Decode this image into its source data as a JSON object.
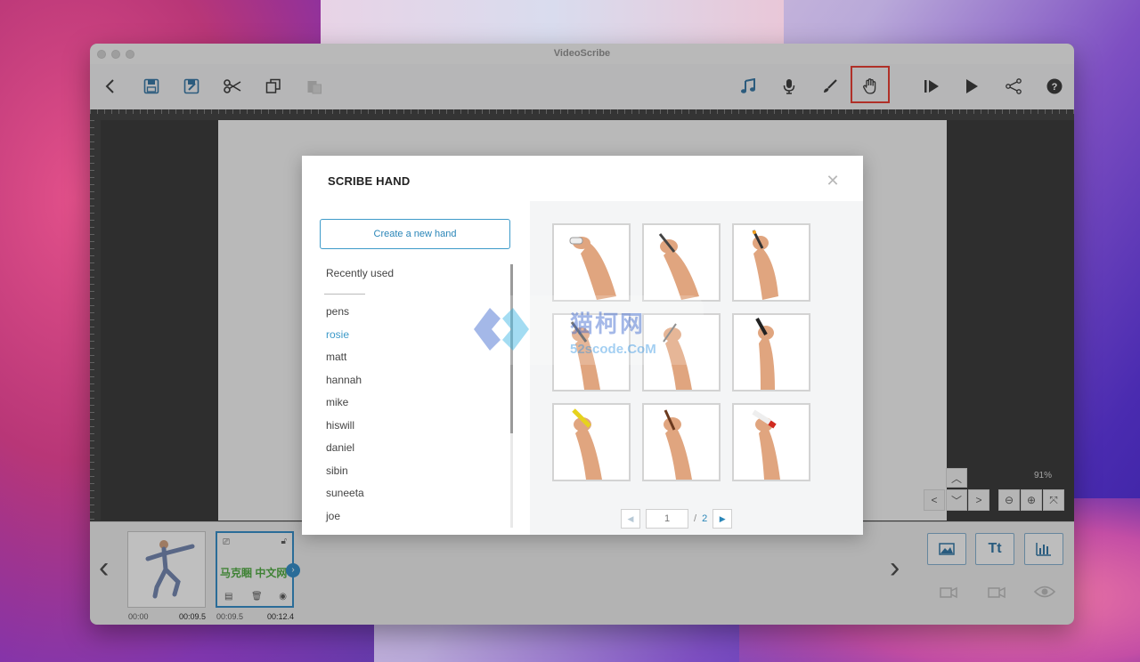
{
  "window": {
    "title": "VideoScribe"
  },
  "toolbar": {
    "left_icons": [
      "back-icon",
      "save-icon",
      "save-as-icon",
      "cut-icon",
      "copy-icon",
      "paste-icon"
    ],
    "right_icons": [
      "music-icon",
      "microphone-icon",
      "brush-icon",
      "hand-icon",
      "preview-from-icon",
      "play-icon",
      "share-icon",
      "help-icon"
    ],
    "active": "hand-icon",
    "active_color": "#e0362b"
  },
  "canvas": {
    "zoom": "91%"
  },
  "timeline": {
    "frames": [
      {
        "start": "00:00",
        "end": "00:09.5"
      },
      {
        "start": "00:09.5",
        "end": "00:12.4",
        "text": "马克睏 中文网"
      }
    ],
    "buttons": {
      "image": "image-icon",
      "text": "Tt",
      "chart": "chart-icon"
    }
  },
  "modal": {
    "title": "SCRIBE HAND",
    "create_button": "Create a new hand",
    "section": "Recently used",
    "hands": [
      "pens",
      "rosie",
      "matt",
      "hannah",
      "mike",
      "hiswill",
      "daniel",
      "sibin",
      "suneeta",
      "joe"
    ],
    "selected": "rosie",
    "pager": {
      "current": "1",
      "separator": "/",
      "total": "2"
    },
    "accent": "#3d9ac9"
  },
  "watermark": {
    "line1": "猫柯网",
    "line2": "52scode.CoM"
  }
}
